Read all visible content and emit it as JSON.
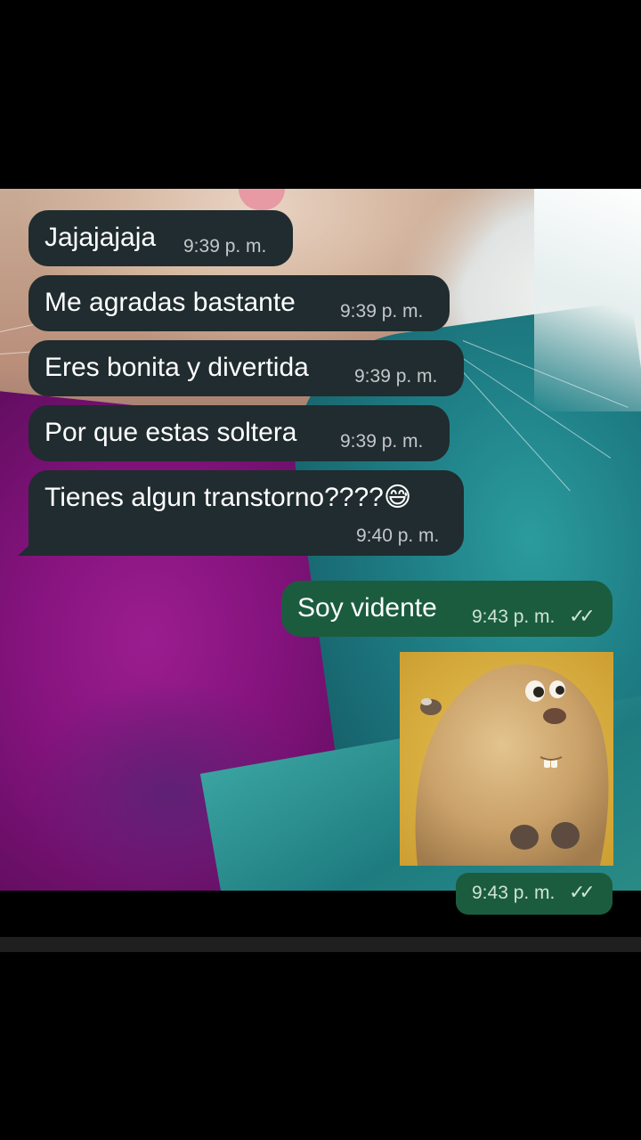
{
  "messages": [
    {
      "direction": "incoming",
      "text": "Jajajajaja",
      "time": "9:39 p. m."
    },
    {
      "direction": "incoming",
      "text": "Me agradas bastante",
      "time": "9:39 p. m."
    },
    {
      "direction": "incoming",
      "text": "Eres bonita y divertida",
      "time": "9:39 p. m."
    },
    {
      "direction": "incoming",
      "text": "Por que estas soltera",
      "time": "9:39 p. m."
    },
    {
      "direction": "incoming",
      "text": "Tienes algun transtorno????😅",
      "time": "9:40 p. m."
    },
    {
      "direction": "outgoing",
      "text": "Soy vidente",
      "time": "9:43 p. m.",
      "status": "read-double-check"
    },
    {
      "direction": "outgoing",
      "type": "sticker",
      "sticker": "confused-beaver-cartoon",
      "time": "9:43 p. m.",
      "status": "read-double-check"
    }
  ],
  "colors": {
    "incoming_bubble": "#202c2f",
    "outgoing_bubble": "#1b5c3f",
    "text": "#ffffff"
  }
}
